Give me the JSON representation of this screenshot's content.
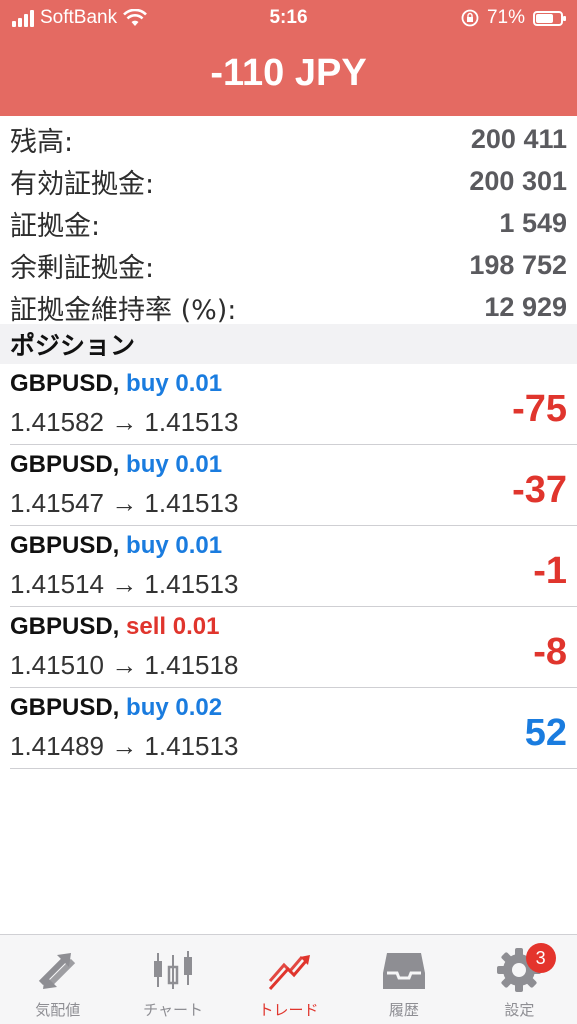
{
  "status": {
    "carrier": "SoftBank",
    "time": "5:16",
    "battery": "71%",
    "battery_level": 0.71
  },
  "header": {
    "title": "-110 JPY"
  },
  "summary": {
    "rows": [
      {
        "label": "残高:",
        "value": "200 411"
      },
      {
        "label": "有効証拠金:",
        "value": "200 301"
      },
      {
        "label": "証拠金:",
        "value": "1 549"
      },
      {
        "label": "余剰証拠金:",
        "value": "198 752"
      },
      {
        "label": "証拠金維持率 (%):",
        "value": "12 929"
      }
    ]
  },
  "positions_section": {
    "title": "ポジション"
  },
  "positions": [
    {
      "symbol": "GBPUSD,",
      "side": "buy 0.01",
      "side_type": "buy",
      "prices": "1.41582 → 1.41513",
      "profit": "-75",
      "profit_sign": "neg"
    },
    {
      "symbol": "GBPUSD,",
      "side": "buy 0.01",
      "side_type": "buy",
      "prices": "1.41547 → 1.41513",
      "profit": "-37",
      "profit_sign": "neg"
    },
    {
      "symbol": "GBPUSD,",
      "side": "buy 0.01",
      "side_type": "buy",
      "prices": "1.41514 → 1.41513",
      "profit": "-1",
      "profit_sign": "neg"
    },
    {
      "symbol": "GBPUSD,",
      "side": "sell 0.01",
      "side_type": "sell",
      "prices": "1.41510 → 1.41518",
      "profit": "-8",
      "profit_sign": "neg"
    },
    {
      "symbol": "GBPUSD,",
      "side": "buy 0.02",
      "side_type": "buy",
      "prices": "1.41489 → 1.41513",
      "profit": "52",
      "profit_sign": "pos"
    }
  ],
  "tabbar": {
    "tabs": [
      {
        "label": "気配値",
        "icon": "quotes-arrows-icon"
      },
      {
        "label": "チャート",
        "icon": "candlestick-chart-icon"
      },
      {
        "label": "トレード",
        "icon": "trade-trend-icon",
        "active": true
      },
      {
        "label": "履歴",
        "icon": "history-tray-icon"
      },
      {
        "label": "設定",
        "icon": "gear-icon",
        "badge": "3"
      }
    ]
  },
  "colors": {
    "header_bg": "#e46a62",
    "buy": "#1a7cdf",
    "sell": "#e0352d",
    "tab_active": "#e0352d",
    "tab_inactive": "#8e8e93"
  }
}
